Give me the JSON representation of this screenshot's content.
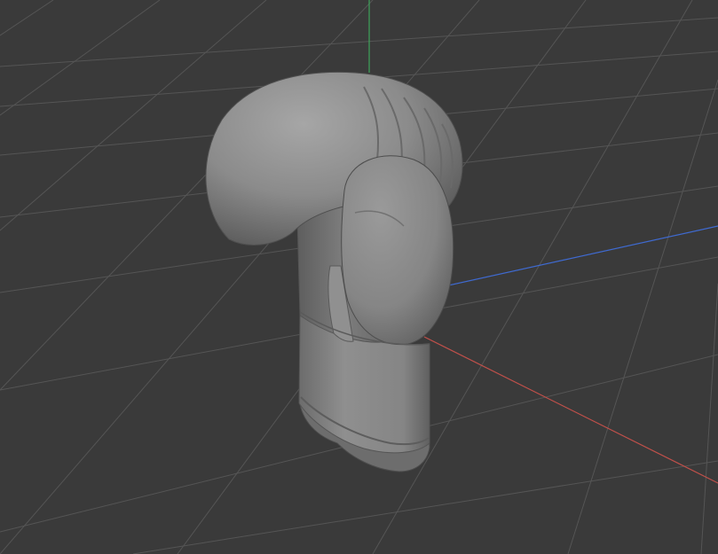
{
  "viewport": {
    "mode": "perspective",
    "background": "#3a3a3a",
    "grid": {
      "visible": true,
      "color": "#555555"
    },
    "axes": {
      "x": {
        "color": "#c0504a"
      },
      "y": {
        "color": "#3fa35a"
      },
      "z": {
        "color": "#3f6ad0"
      }
    }
  },
  "model": {
    "object": "boxing glove",
    "shading": "clay",
    "base_color": "#8f8f8f"
  }
}
